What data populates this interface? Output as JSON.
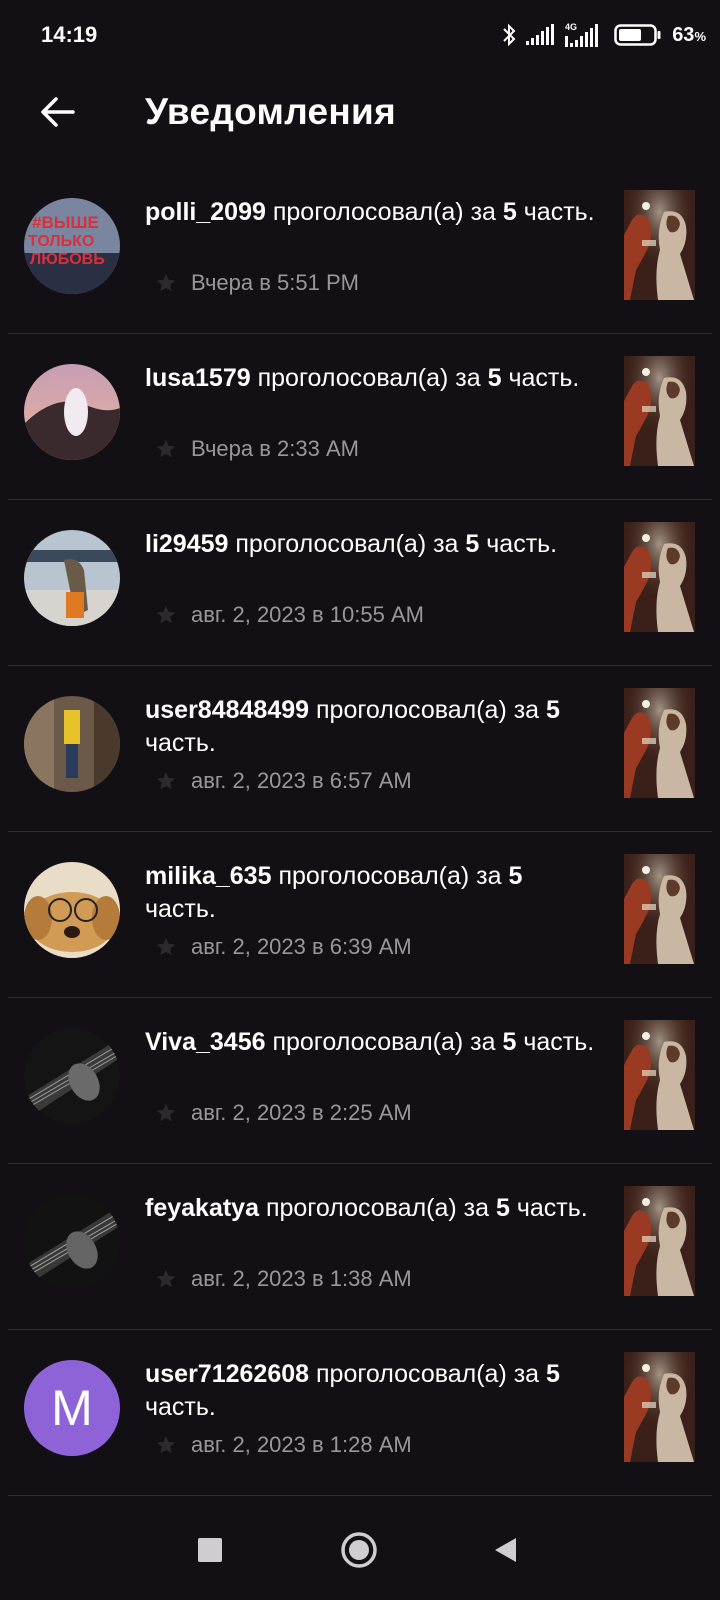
{
  "status_bar": {
    "time": "14:19",
    "battery_percent": "63",
    "battery_unit": "%",
    "network_type": "4G",
    "icons": [
      "bluetooth-icon",
      "signal-icon",
      "signal-4g-icon",
      "battery-icon"
    ]
  },
  "header": {
    "title": "Уведомления",
    "back_icon": "arrow-left-icon"
  },
  "colors": {
    "background": "#121014",
    "text_primary": "#ffffff",
    "text_secondary": "#9a979c",
    "divider": "#2e2b31",
    "avatar_letter_bg": "#8f63d8"
  },
  "notifications": [
    {
      "username": "polli_2099",
      "verb": "проголосовал(а) за",
      "number": "5",
      "part": "часть.",
      "time": "Вчера в 5:51 PM",
      "avatar": "photo"
    },
    {
      "username": "lusa1579",
      "verb": "проголосовал(а) за",
      "number": "5",
      "part": "часть.",
      "time": "Вчера в 2:33 AM",
      "avatar": "photo"
    },
    {
      "username": "li29459",
      "verb": "проголосовал(а) за",
      "number": "5",
      "part": "часть.",
      "time": "авг. 2, 2023 в 10:55 AM",
      "avatar": "photo"
    },
    {
      "username": "user84848499",
      "verb": "проголосовал(а) за",
      "number": "5",
      "part": "часть.",
      "time": "авг. 2, 2023 в 6:57 AM",
      "avatar": "photo"
    },
    {
      "username": "milika_635",
      "verb": "проголосовал(а) за",
      "number": "5",
      "part": "часть.",
      "time": "авг. 2, 2023 в 6:39 AM",
      "avatar": "photo"
    },
    {
      "username": "Viva_3456",
      "verb": "проголосовал(а) за",
      "number": "5",
      "part": "часть.",
      "time": "авг. 2, 2023 в 2:25 AM",
      "avatar": "photo"
    },
    {
      "username": "feyakatya",
      "verb": "проголосовал(а) за",
      "number": "5",
      "part": "часть.",
      "time": "авг. 2, 2023 в 1:38 AM",
      "avatar": "photo"
    },
    {
      "username": "user71262608",
      "verb": "проголосовал(а) за",
      "number": "5",
      "part": "часть.",
      "time": "авг. 2, 2023 в 1:28 AM",
      "avatar": "letter",
      "avatar_letter": "M"
    }
  ],
  "nav_bar": {
    "recent_icon": "square-icon",
    "home_icon": "circle-home-icon",
    "back_icon": "triangle-back-icon"
  }
}
